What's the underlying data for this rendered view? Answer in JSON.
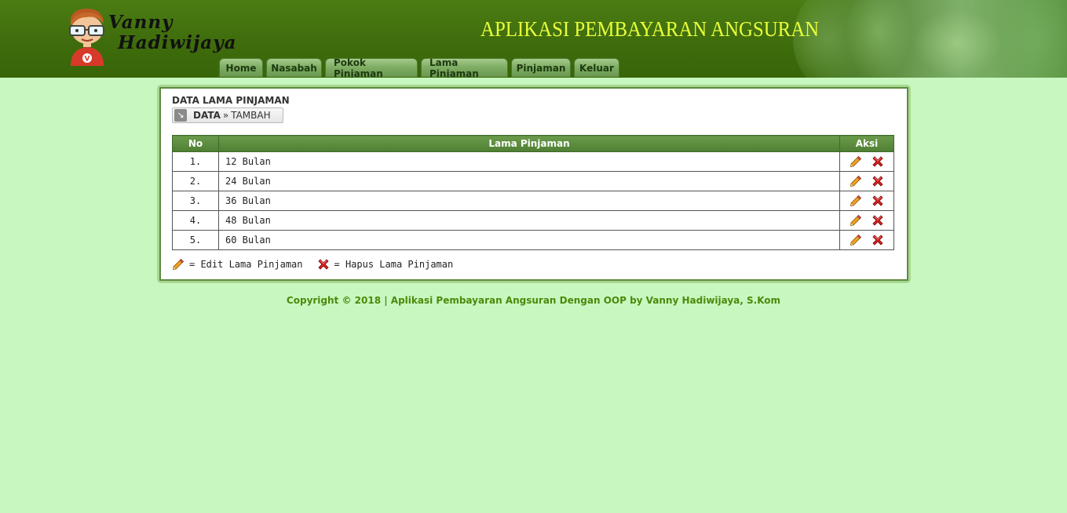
{
  "header": {
    "logo_line1": "Vanny",
    "logo_line2": "Hadiwijaya",
    "app_title": "APLIKASI PEMBAYARAN ANGSURAN",
    "accent_color": "#e8ff3a"
  },
  "nav": {
    "items": [
      {
        "label": "Home"
      },
      {
        "label": "Nasabah"
      },
      {
        "label": "Pokok Pinjaman"
      },
      {
        "label": "Lama Pinjaman"
      },
      {
        "label": "Pinjaman"
      },
      {
        "label": "Keluar"
      }
    ]
  },
  "panel": {
    "title": "DATA LAMA PINJAMAN",
    "breadcrumb": {
      "current": "DATA",
      "separator": "»",
      "link": "TAMBAH"
    }
  },
  "table": {
    "headers": {
      "no": "No",
      "lama": "Lama Pinjaman",
      "aksi": "Aksi"
    },
    "rows": [
      {
        "no": "1.",
        "lama": "12 Bulan"
      },
      {
        "no": "2.",
        "lama": "24 Bulan"
      },
      {
        "no": "3.",
        "lama": "36 Bulan"
      },
      {
        "no": "4.",
        "lama": "48 Bulan"
      },
      {
        "no": "5.",
        "lama": "60 Bulan"
      }
    ]
  },
  "legend": {
    "edit": "= Edit Lama Pinjaman",
    "hapus": "= Hapus Lama Pinjaman"
  },
  "footer": {
    "text": "Copyright © 2018 | Aplikasi Pembayaran Angsuran Dengan OOP by Vanny Hadiwijaya, S.Kom"
  }
}
